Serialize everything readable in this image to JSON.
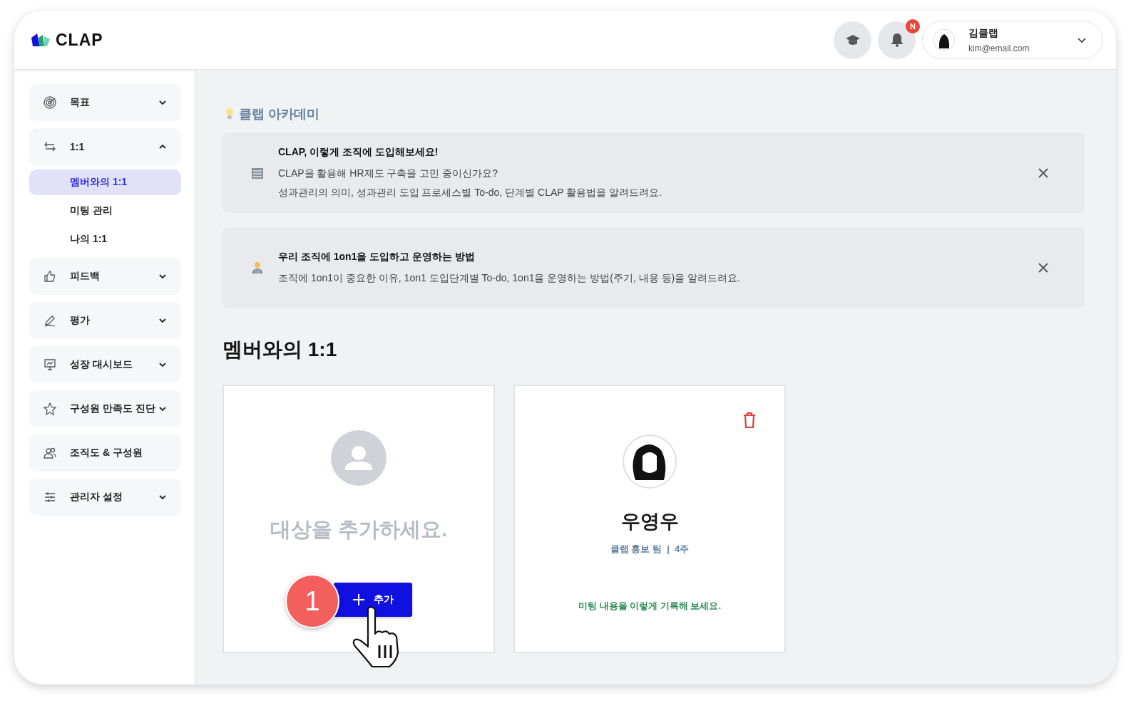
{
  "header": {
    "logo": "CLAP",
    "notification_badge": "N",
    "user": {
      "name": "김클랩",
      "email": "kim@email.com"
    }
  },
  "sidebar": {
    "items": [
      {
        "label": "목표",
        "kind": "group",
        "expanded": false
      },
      {
        "label": "1:1",
        "kind": "group",
        "expanded": true,
        "children": [
          {
            "label": "멤버와의 1:1",
            "selected": true
          },
          {
            "label": "미팅 관리",
            "selected": false
          },
          {
            "label": "나의 1:1",
            "selected": false
          }
        ]
      },
      {
        "label": "피드백",
        "kind": "group",
        "expanded": false
      },
      {
        "label": "평가",
        "kind": "group",
        "expanded": false
      },
      {
        "label": "성장 대시보드",
        "kind": "group",
        "expanded": false
      },
      {
        "label": "구성원 만족도 진단",
        "kind": "group",
        "expanded": false
      },
      {
        "label": "조직도 & 구성원",
        "kind": "link"
      },
      {
        "label": "관리자 설정",
        "kind": "group",
        "expanded": false
      }
    ]
  },
  "academy": {
    "title": "클랩 아카데미",
    "notices": [
      {
        "title": "CLAP, 이렇게 조직에 도입해보세요!",
        "lines": [
          "CLAP을 활용해 HR제도 구축을 고민 중이신가요?",
          "성과관리의 의미, 성과관리 도입 프로세스별 To-do, 단계별 CLAP 활용법을 알려드려요."
        ]
      },
      {
        "title": "우리 조직에 1on1을 도입하고 운영하는 방법",
        "lines": [
          "조직에 1on1이 중요한 이유, 1on1 도입단계별 To-do, 1on1을 운영하는 방법(주기, 내용 등)을 알려드려요."
        ]
      }
    ]
  },
  "page_title": "멤버와의 1:1",
  "cards": [
    {
      "kind": "add",
      "prompt": "대상을 추가하세요.",
      "button": "추가",
      "step": "1"
    },
    {
      "kind": "member",
      "name": "우영우",
      "team": "클랩 홍보 팀  |  4주",
      "link": "미팅 내용을 이렇게 기록해 보세요."
    }
  ]
}
